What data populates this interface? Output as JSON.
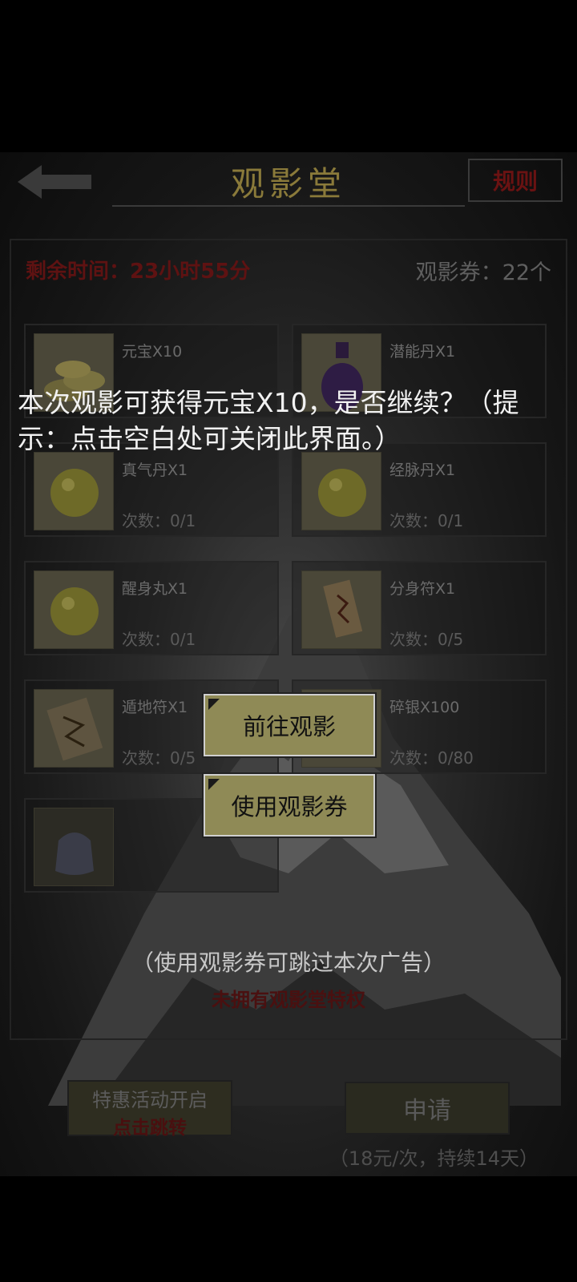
{
  "header": {
    "title": "观影堂",
    "rules_label": "规则"
  },
  "status": {
    "remaining_time": "剩余时间：23小时55分",
    "tickets": "观影券：22个"
  },
  "rewards": [
    {
      "name": "元宝X10",
      "count": "",
      "icon": "gold-ingot-icon"
    },
    {
      "name": "潜能丹X1",
      "count": "",
      "icon": "potion-bottle-icon"
    },
    {
      "name": "真气丹X1",
      "count": "次数：0/1",
      "icon": "yellow-pill-icon"
    },
    {
      "name": "经脉丹X1",
      "count": "次数：0/1",
      "icon": "yellow-pill-icon"
    },
    {
      "name": "醒身丸X1",
      "count": "次数：0/1",
      "icon": "yellow-pill-icon"
    },
    {
      "name": "分身符X1",
      "count": "次数：0/5",
      "icon": "talisman-icon"
    },
    {
      "name": "遁地符X1",
      "count": "次数：0/5",
      "icon": "scroll-talisman-icon"
    },
    {
      "name": "碎银X100",
      "count": "次数：0/80",
      "icon": "silver-icon"
    },
    {
      "name": "",
      "count": "",
      "icon": "bag-icon"
    }
  ],
  "privilege_text": "未拥有观影堂特权",
  "promo": {
    "line1": "特惠活动开启",
    "line2": "点击跳转"
  },
  "apply": {
    "label": "申请",
    "price": "（18元/次，持续14天）"
  },
  "dialog": {
    "message": "本次观影可获得元宝X10，是否继续？（提示：点击空白处可关闭此界面。）",
    "go_label": "前往观影",
    "ticket_label": "使用观影券",
    "skip_hint": "（使用观影券可跳过本次广告）"
  },
  "colors": {
    "button_fill": "#8f8a56",
    "warning_red": "#5e1212",
    "title_gold": "#8a7a3a"
  }
}
